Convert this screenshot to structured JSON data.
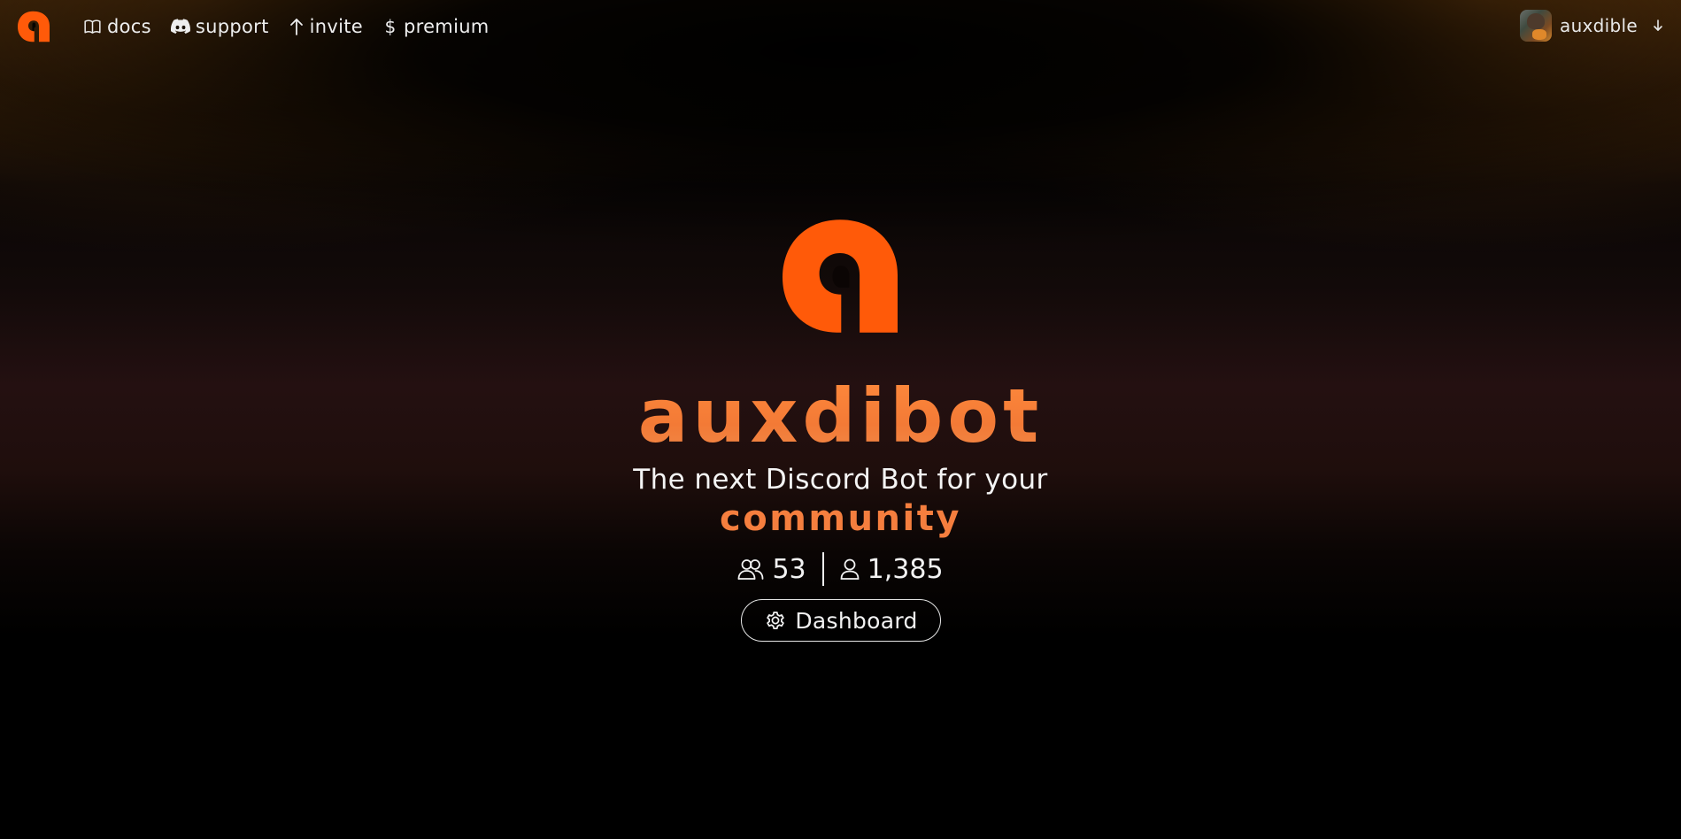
{
  "nav": {
    "logo_icon": "auxdibot-logo-icon",
    "links": [
      {
        "label": "docs",
        "icon": "book-icon"
      },
      {
        "label": "support",
        "icon": "discord-icon"
      },
      {
        "label": "invite",
        "icon": "arrow-up-icon"
      },
      {
        "label": "premium",
        "icon": "dollar-icon"
      }
    ],
    "user": {
      "name": "auxdible",
      "dropdown_icon": "arrow-down-icon"
    }
  },
  "hero": {
    "logo_icon": "auxdibot-logo-icon",
    "title": "auxdibot",
    "tagline": "The next Discord Bot for your",
    "tagline_accent": "community",
    "stats": {
      "servers": "53",
      "servers_icon": "users-icon",
      "users": "1,385",
      "users_icon": "user-icon"
    },
    "dashboard_button": {
      "label": "Dashboard",
      "icon": "gear-icon"
    }
  },
  "colors": {
    "brand_orange": "#ff5a09",
    "title_orange": "#f57e3e",
    "background": "#000000"
  }
}
